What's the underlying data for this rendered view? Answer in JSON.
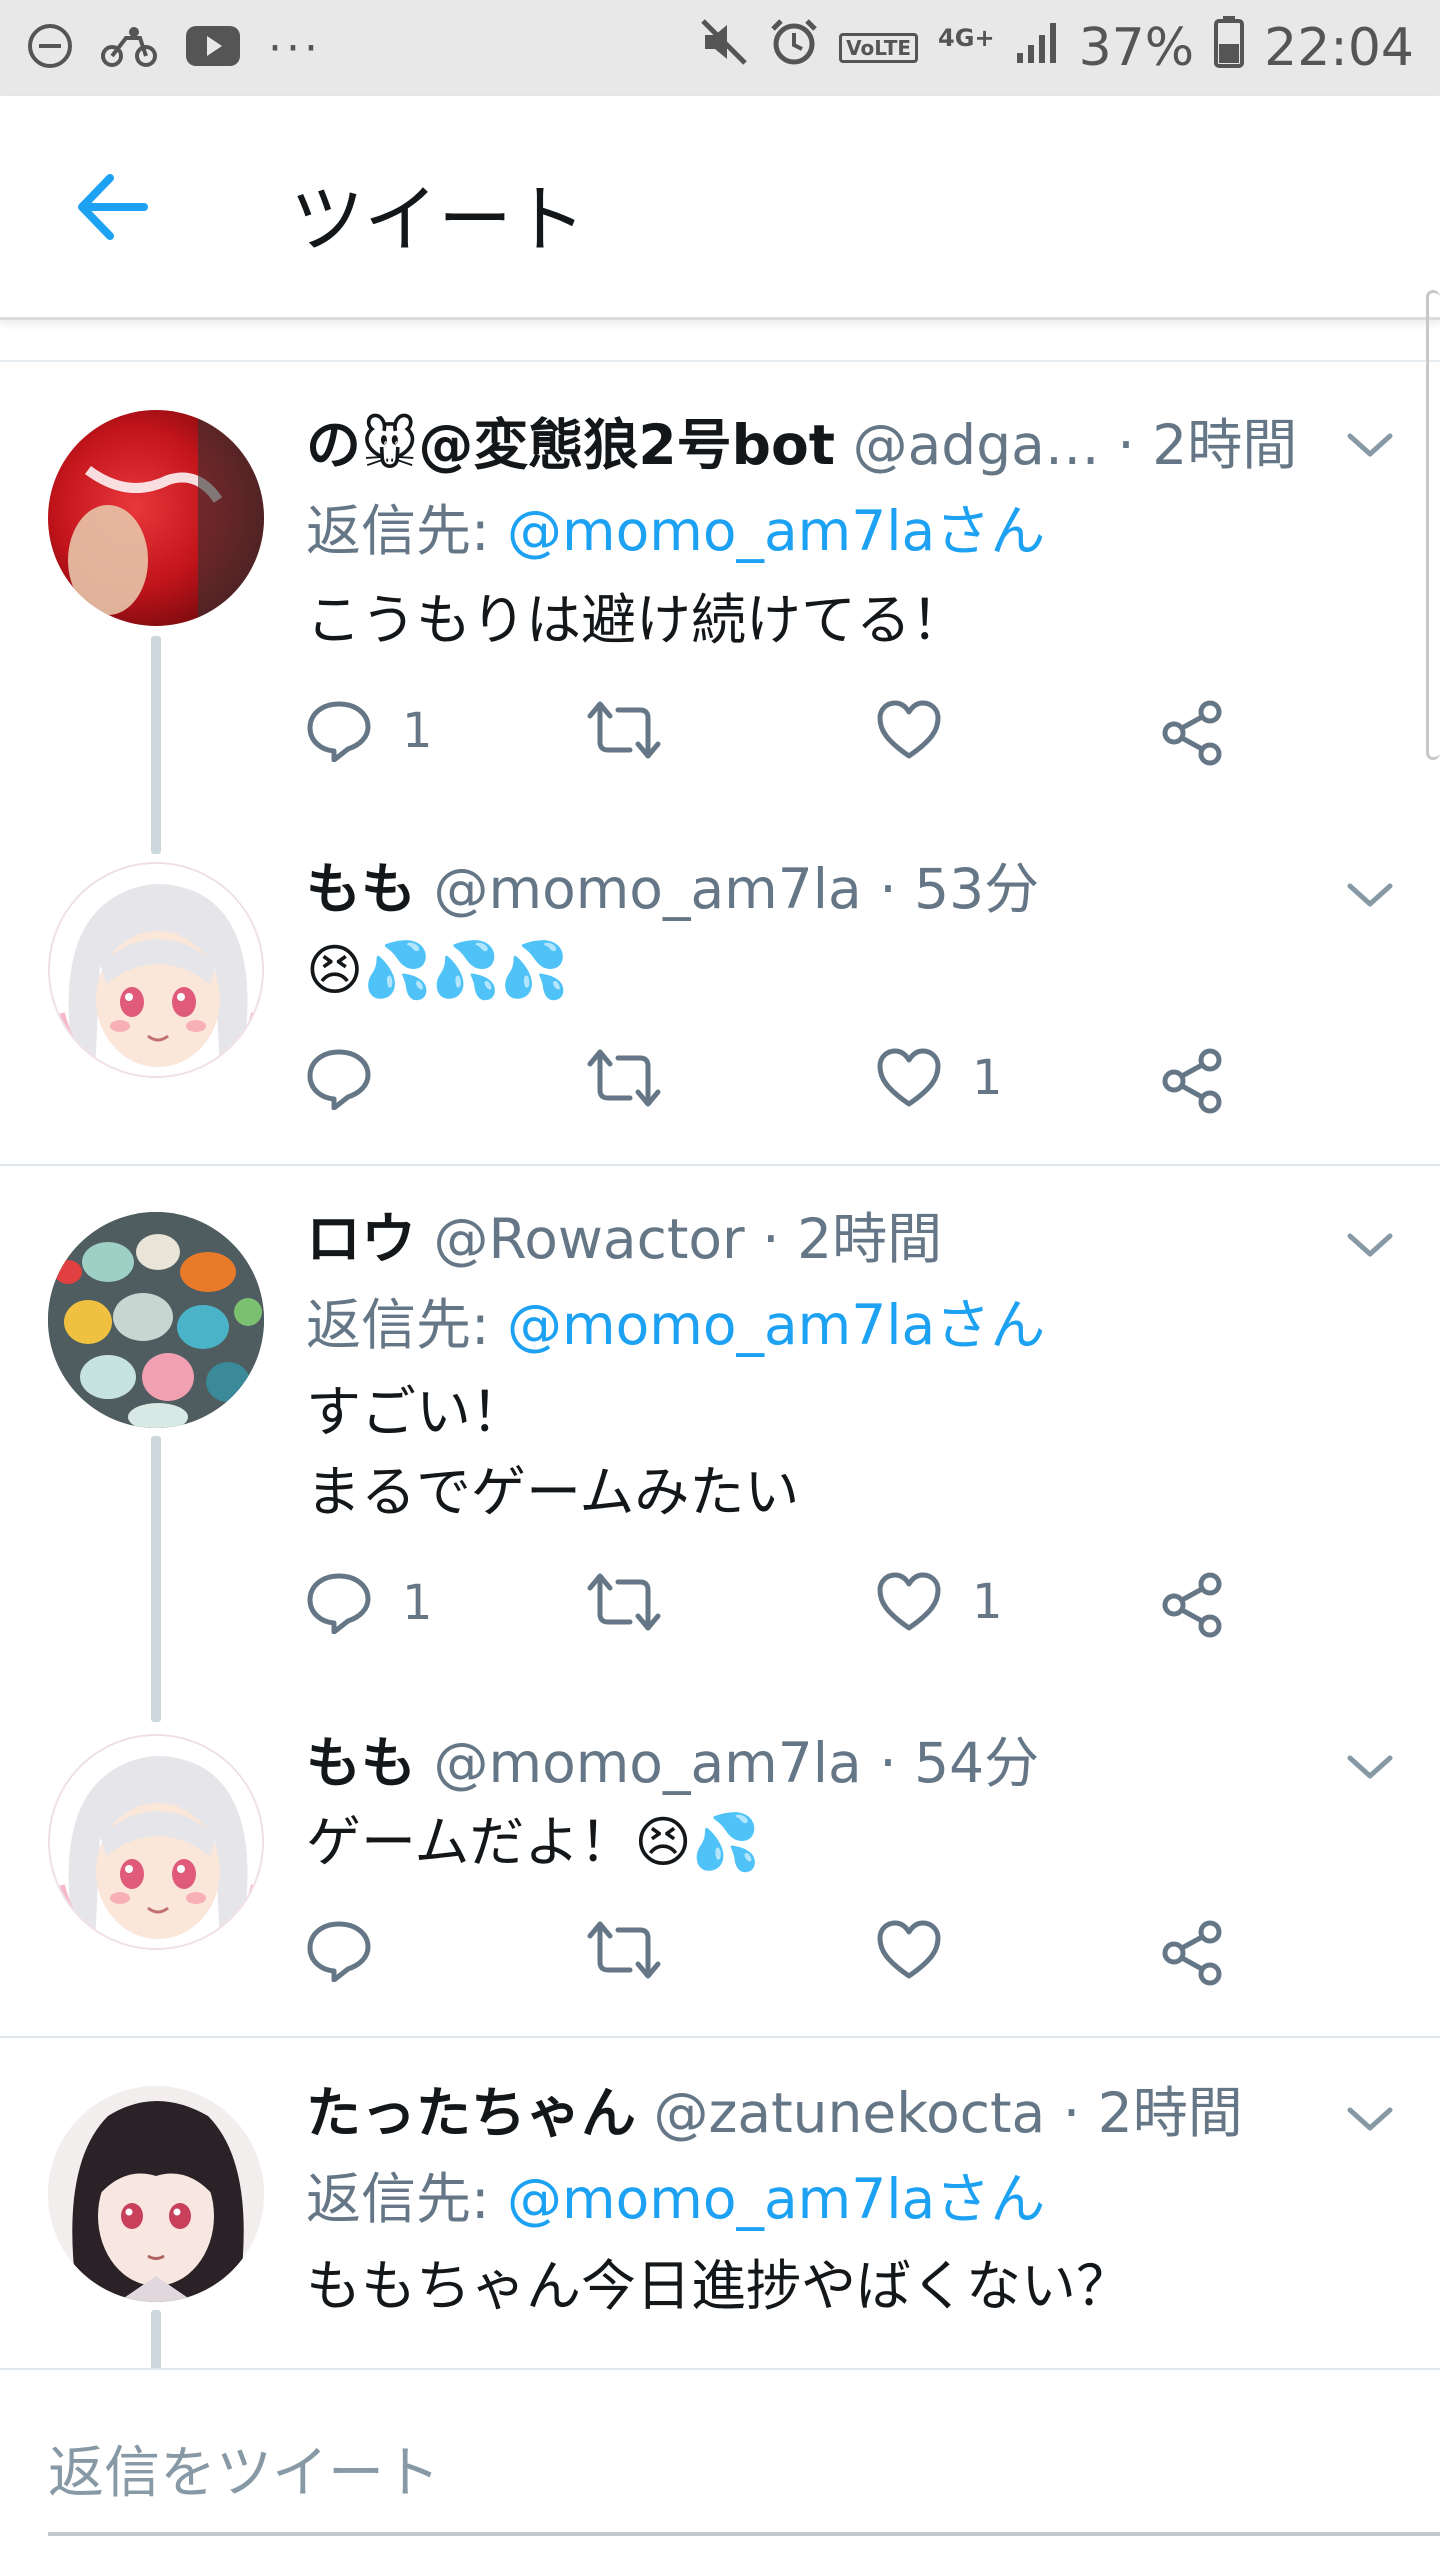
{
  "status_bar": {
    "battery": "37%",
    "time": "22:04",
    "network": "4G+",
    "volte": "VoLTE",
    "more": "···",
    "left_icons": [
      "dnd-icon",
      "motorbike-icon",
      "youtube-icon"
    ],
    "right_icons": [
      "mute-icon",
      "alarm-icon",
      "volte-icon",
      "signal-icon",
      "battery-icon"
    ]
  },
  "header": {
    "title": "ツイート",
    "back_icon": "arrow-left-icon"
  },
  "colors": {
    "accent": "#1da1f2",
    "secondary_text": "#657786",
    "thread_line": "#ccd6dd",
    "primary_text": "#14171a"
  },
  "tweets": [
    {
      "name": "の🐭@変態狼2号bot",
      "handle": "@adga…",
      "time": "· 2時間",
      "reply_prefix": "返信先:",
      "reply_to": "@momo_am7laさん",
      "text": "こうもりは避け続けてる！",
      "replies": "1",
      "retweets": "",
      "likes": ""
    },
    {
      "name": "もも",
      "handle": "@momo_am7la",
      "time": "· 53分",
      "text": "😣💦💦💦",
      "replies": "",
      "retweets": "",
      "likes": "1"
    },
    {
      "name": "ロウ",
      "handle": "@Rowactor",
      "time": "· 2時間",
      "reply_prefix": "返信先:",
      "reply_to": "@momo_am7laさん",
      "text": "すごい！\nまるでゲームみたい",
      "replies": "1",
      "retweets": "",
      "likes": "1"
    },
    {
      "name": "もも",
      "handle": "@momo_am7la",
      "time": "· 54分",
      "text": "ゲームだよ！😣💦",
      "replies": "",
      "retweets": "",
      "likes": ""
    },
    {
      "name": "たったちゃん",
      "handle": "@zatunekocta",
      "time": "· 2時間",
      "reply_prefix": "返信先:",
      "reply_to": "@momo_am7laさん",
      "text": "ももちゃん今日進捗やばくない？"
    }
  ],
  "composer": {
    "placeholder": "返信をツイート"
  }
}
